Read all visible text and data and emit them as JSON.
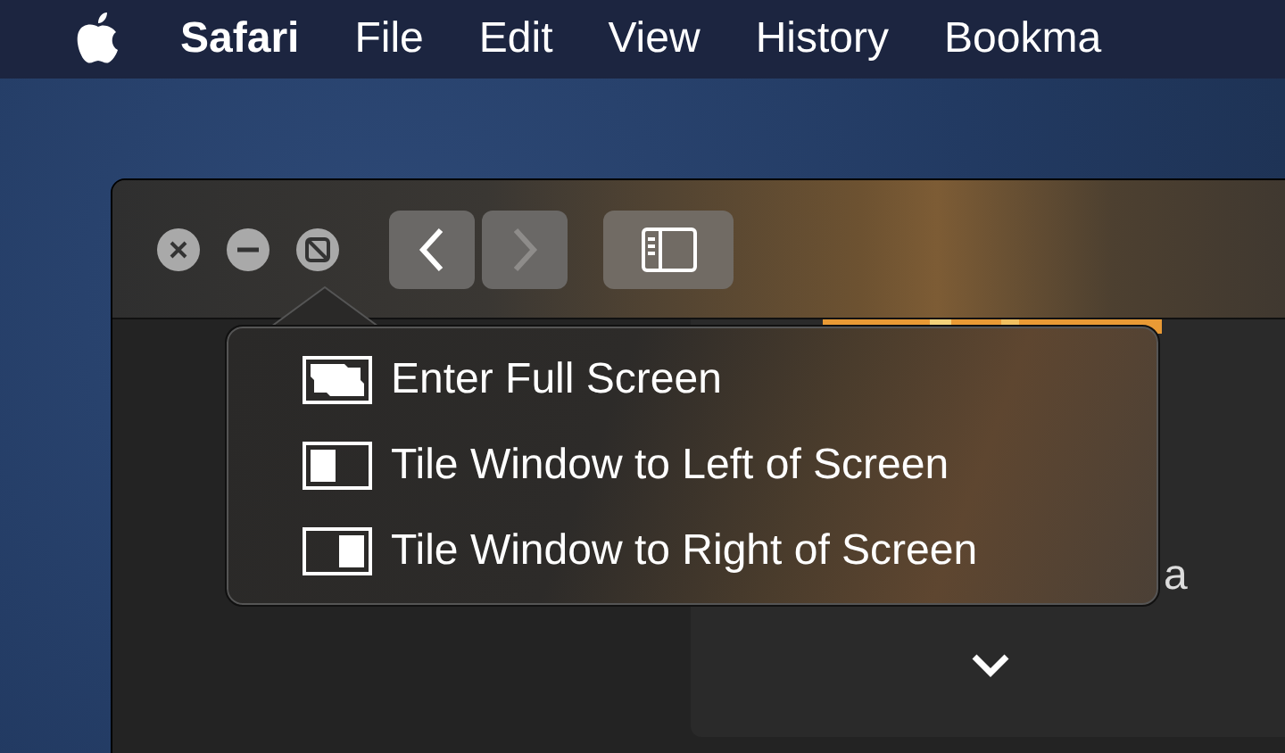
{
  "menu_bar": {
    "app_name": "Safari",
    "items": [
      "File",
      "Edit",
      "View",
      "History",
      "Bookma"
    ]
  },
  "window": {
    "toolbar": {
      "buttons": [
        {
          "kind": "back",
          "disabled": false
        },
        {
          "kind": "forward",
          "disabled": true
        },
        {
          "kind": "sidebar",
          "disabled": false
        }
      ]
    },
    "content": {
      "partial_text": "a"
    }
  },
  "popover": {
    "items": [
      {
        "kind": "fullscreen",
        "label": "Enter Full Screen"
      },
      {
        "kind": "tile-left",
        "label": "Tile Window to Left of Screen"
      },
      {
        "kind": "tile-right",
        "label": "Tile Window to Right of Screen"
      }
    ]
  }
}
